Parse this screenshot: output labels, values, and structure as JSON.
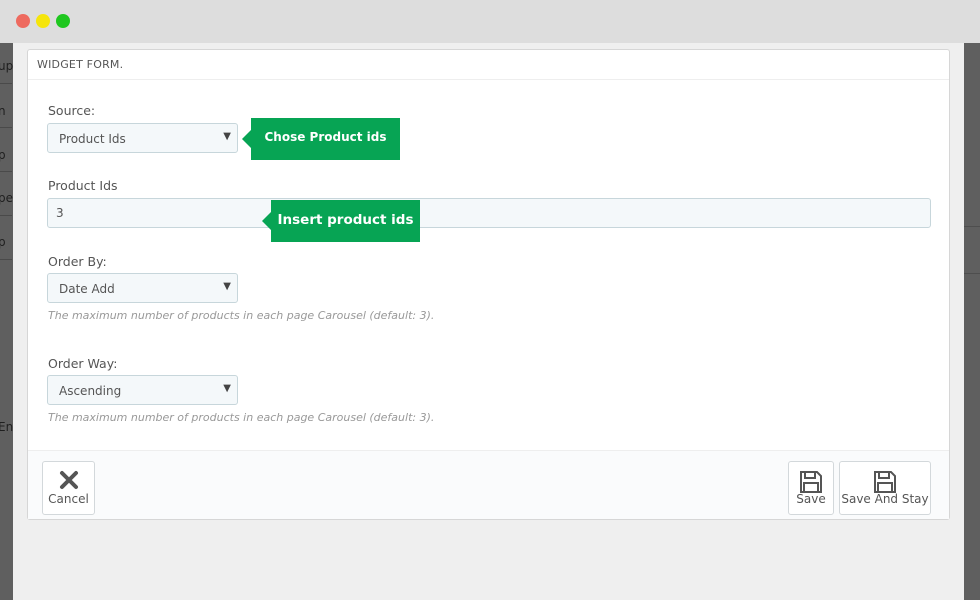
{
  "window": {
    "controls": [
      "close",
      "minimize",
      "maximize"
    ]
  },
  "background_fragments": [
    "up",
    "n",
    "p",
    "pe",
    "p",
    "En"
  ],
  "form": {
    "title": "WIDGET FORM.",
    "source": {
      "label": "Source:",
      "value": "Product Ids"
    },
    "product_ids": {
      "label": "Product Ids",
      "value": "3"
    },
    "order_by": {
      "label": "Order By:",
      "value": "Date Add",
      "help": "The maximum number of products in each page Carousel (default: 3)."
    },
    "order_way": {
      "label": "Order Way:",
      "value": "Ascending",
      "help": "The maximum number of products in each page Carousel (default: 3)."
    }
  },
  "footer": {
    "cancel_label": "Cancel",
    "save_label": "Save",
    "save_stay_label": "Save And Stay"
  },
  "callouts": {
    "source_tip": "Chose Product ids",
    "product_ids_tip": "Insert product ids"
  },
  "colors": {
    "callout": "#07a454",
    "titlebar": "#dddddd"
  }
}
